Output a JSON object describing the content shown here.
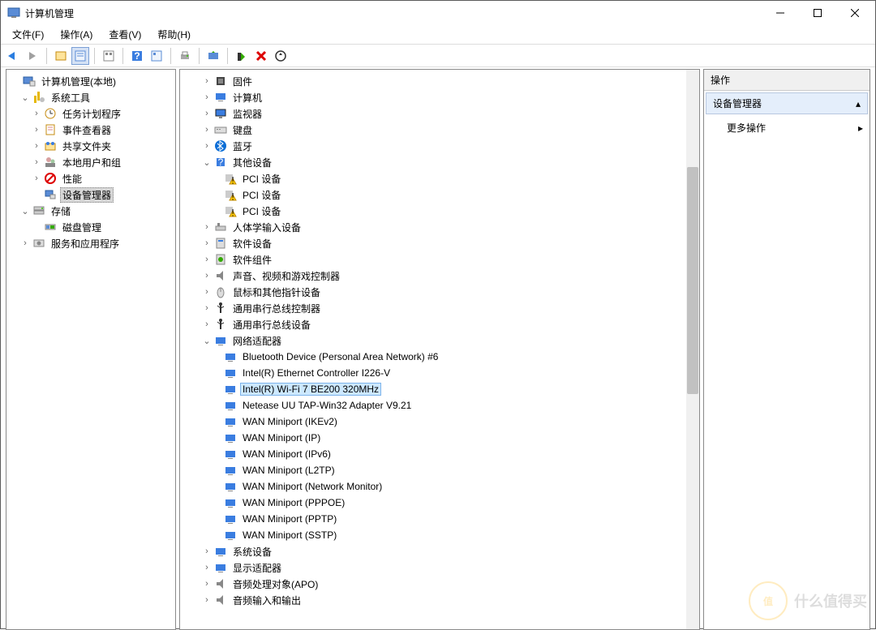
{
  "window": {
    "title": "计算机管理"
  },
  "menu": {
    "file": "文件(F)",
    "action": "操作(A)",
    "view": "查看(V)",
    "help": "帮助(H)"
  },
  "leftTree": {
    "root": "计算机管理(本地)",
    "systemTools": "系统工具",
    "taskScheduler": "任务计划程序",
    "eventViewer": "事件查看器",
    "sharedFolders": "共享文件夹",
    "localUsers": "本地用户和组",
    "performance": "性能",
    "deviceManager": "设备管理器",
    "storage": "存储",
    "diskMgmt": "磁盘管理",
    "services": "服务和应用程序"
  },
  "deviceTree": {
    "firmware": "固件",
    "computer": "计算机",
    "monitors": "监视器",
    "keyboards": "键盘",
    "bluetooth": "蓝牙",
    "otherDevices": "其他设备",
    "pciDevice": "PCI 设备",
    "hid": "人体学输入设备",
    "softDev": "软件设备",
    "softComp": "软件组件",
    "sound": "声音、视频和游戏控制器",
    "mouse": "鼠标和其他指针设备",
    "usbCtrl": "通用串行总线控制器",
    "usbDev": "通用串行总线设备",
    "network": "网络适配器",
    "net1": "Bluetooth Device (Personal Area Network) #6",
    "net2": "Intel(R) Ethernet Controller I226-V",
    "net3": "Intel(R) Wi-Fi 7 BE200 320MHz",
    "net4": "Netease UU TAP-Win32 Adapter V9.21",
    "net5": "WAN Miniport (IKEv2)",
    "net6": "WAN Miniport (IP)",
    "net7": "WAN Miniport (IPv6)",
    "net8": "WAN Miniport (L2TP)",
    "net9": "WAN Miniport (Network Monitor)",
    "net10": "WAN Miniport (PPPOE)",
    "net11": "WAN Miniport (PPTP)",
    "net12": "WAN Miniport (SSTP)",
    "sysDev": "系统设备",
    "display": "显示适配器",
    "audioProc": "音频处理对象(APO)",
    "audioIO": "音频输入和输出"
  },
  "actions": {
    "header": "操作",
    "section": "设备管理器",
    "more": "更多操作"
  },
  "watermark": {
    "badge": "值",
    "text": "什么值得买"
  }
}
